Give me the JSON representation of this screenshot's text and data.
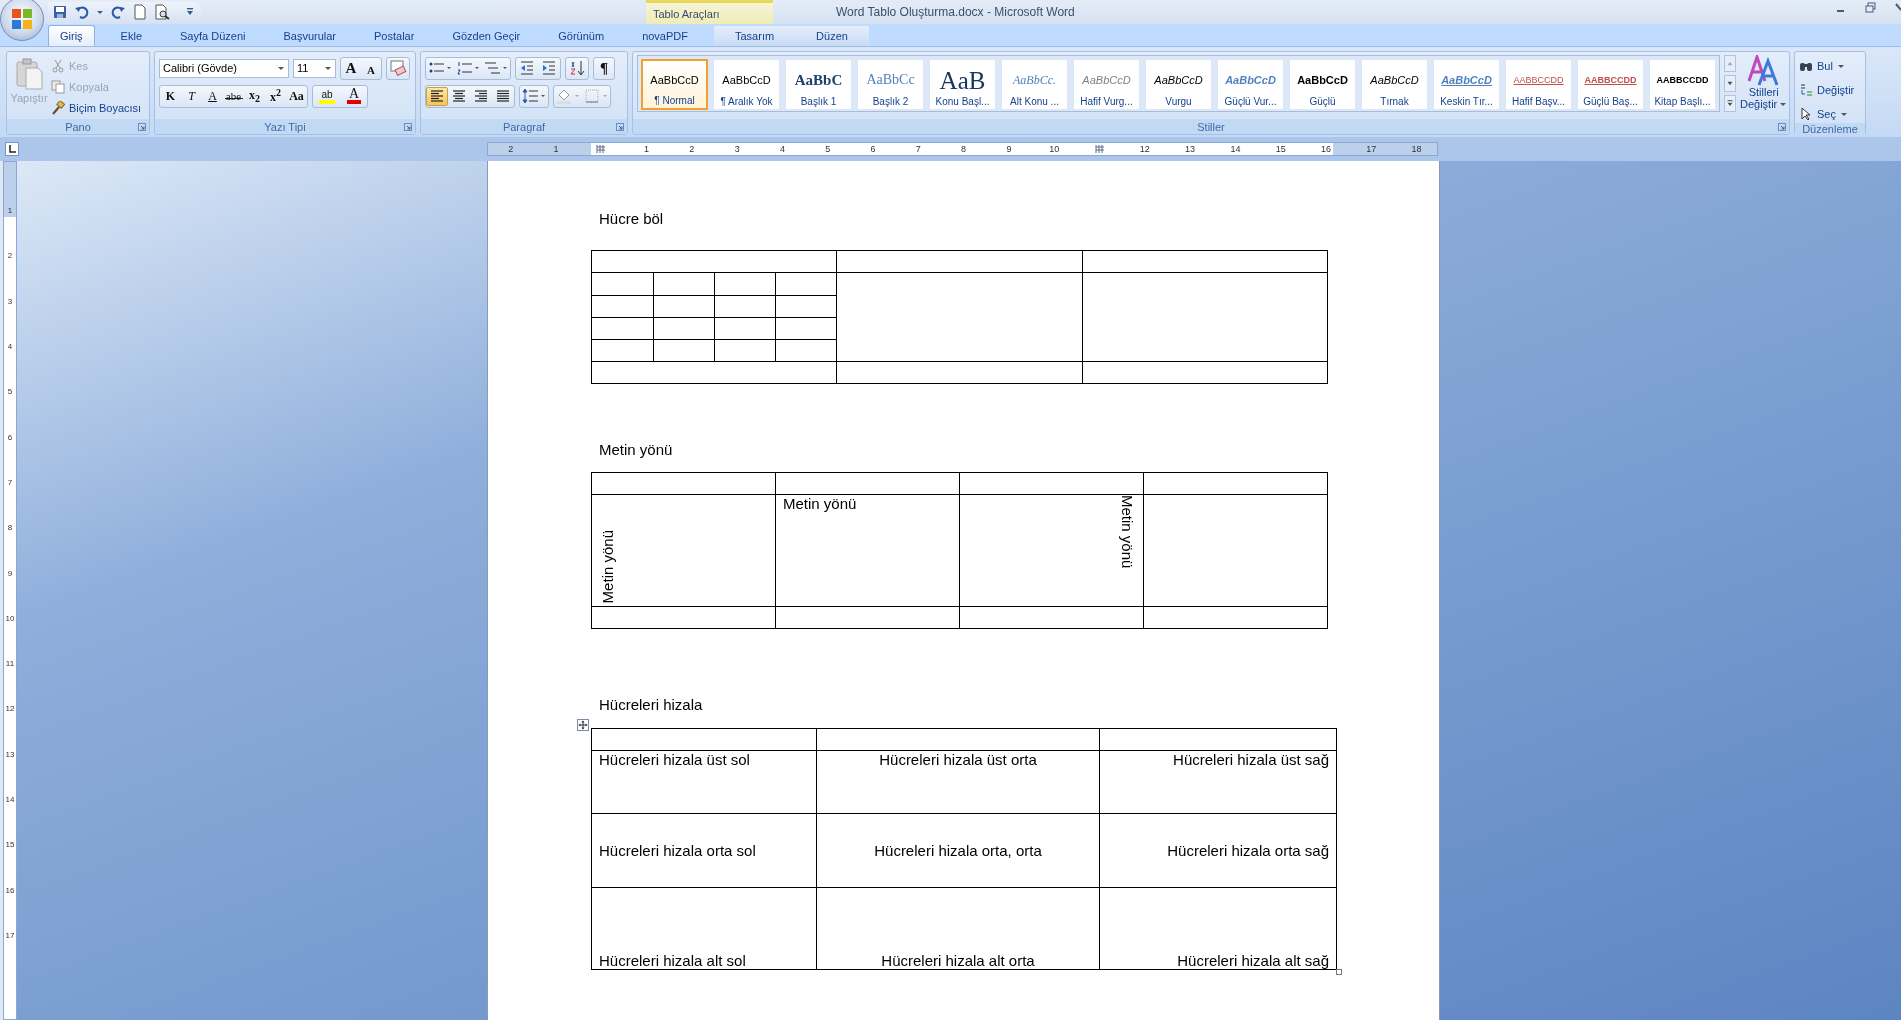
{
  "window": {
    "title": "Word Tablo Oluşturma.docx - Microsoft Word",
    "contextual_group": "Tablo Araçları"
  },
  "tabs": [
    {
      "label": "Giriş",
      "selected": true,
      "kind": "normal"
    },
    {
      "label": "Ekle",
      "selected": false,
      "kind": "normal"
    },
    {
      "label": "Sayfa Düzeni",
      "selected": false,
      "kind": "normal"
    },
    {
      "label": "Başvurular",
      "selected": false,
      "kind": "normal"
    },
    {
      "label": "Postalar",
      "selected": false,
      "kind": "normal"
    },
    {
      "label": "Gözden Geçir",
      "selected": false,
      "kind": "normal"
    },
    {
      "label": "Görünüm",
      "selected": false,
      "kind": "normal"
    },
    {
      "label": "novaPDF",
      "selected": false,
      "kind": "normal"
    },
    {
      "label": "Tasarım",
      "selected": false,
      "kind": "contextual"
    },
    {
      "label": "Düzen",
      "selected": false,
      "kind": "contextual"
    }
  ],
  "clipboard": {
    "group": "Pano",
    "paste": {
      "label": "Yapıştır",
      "disabled": true
    },
    "items": [
      {
        "label": "Kes",
        "kind": "cut",
        "disabled": true
      },
      {
        "label": "Kopyala",
        "kind": "copy",
        "disabled": true
      },
      {
        "label": "Biçim Boyacısı",
        "kind": "brush",
        "disabled": false
      }
    ]
  },
  "font": {
    "group": "Yazı Tipi",
    "family": "Calibri (Gövde)",
    "size": "11",
    "grow": "A",
    "shrink": "A",
    "buttons": [
      {
        "label": "K",
        "kind": "bold"
      },
      {
        "label": "T",
        "kind": "italic"
      },
      {
        "label": "A",
        "kind": "underline"
      },
      {
        "label": "abe",
        "kind": "strike"
      },
      {
        "label": "x$_{2}$",
        "kind": "sub"
      },
      {
        "label": "x$^{2}$",
        "kind": "sup"
      },
      {
        "label": "Aa",
        "kind": "case"
      }
    ],
    "highlight_label": "ab",
    "color_label": "A"
  },
  "paragraph": {
    "group": "Paragraf",
    "pilcrow": "¶",
    "alignments": [
      {
        "kind": "left",
        "selected": true
      },
      {
        "kind": "center",
        "selected": false
      },
      {
        "kind": "right",
        "selected": false
      },
      {
        "kind": "justify",
        "selected": false
      }
    ]
  },
  "styles": {
    "group": "Stiller",
    "change_label": "Stilleri",
    "change_label_2": "Değiştir",
    "items": [
      {
        "sample": "AaBbCcD",
        "label": "¶ Normal",
        "selected": true
      },
      {
        "sample": "AaBbCcD",
        "label": "¶ Aralık Yok",
        "selected": false
      },
      {
        "sample": "AaBbC",
        "label": "Başlık 1",
        "selected": false
      },
      {
        "sample": "AaBbCc",
        "label": "Başlık 2",
        "selected": false
      },
      {
        "sample": "AaB",
        "label": "Konu Başl...",
        "selected": false
      },
      {
        "sample": "AaBbCc.",
        "label": "Alt Konu ...",
        "selected": false
      },
      {
        "sample": "AaBbCcD",
        "label": "Hafif Vurg...",
        "selected": false
      },
      {
        "sample": "AaBbCcD",
        "label": "Vurgu",
        "selected": false
      },
      {
        "sample": "AaBbCcD",
        "label": "Güçlü Vur...",
        "selected": false
      },
      {
        "sample": "AaBbCcD",
        "label": "Güçlü",
        "selected": false
      },
      {
        "sample": "AaBbCcD",
        "label": "Tırnak",
        "selected": false
      },
      {
        "sample": "AaBbCcD",
        "label": "Keskin Tır...",
        "selected": false
      },
      {
        "sample": "AABBCCDD",
        "label": "Hafif Başv...",
        "selected": false
      },
      {
        "sample": "AABBCCDD",
        "label": "Güçlü Baş...",
        "selected": false
      },
      {
        "sample": "AABBCCDD",
        "label": "Kitap Başlı...",
        "selected": false
      }
    ]
  },
  "editing": {
    "group": "Düzenleme",
    "items": [
      {
        "label": "Bul",
        "kind": "find"
      },
      {
        "label": "Değiştir",
        "kind": "replace"
      },
      {
        "label": "Seç",
        "kind": "select"
      }
    ]
  },
  "ruler": [
    {
      "kind": "number",
      "label": "2"
    },
    {
      "kind": "number",
      "label": "1"
    },
    {
      "kind": "marker"
    },
    {
      "kind": "number",
      "label": "1"
    },
    {
      "kind": "number",
      "label": "2"
    },
    {
      "kind": "number",
      "label": "3"
    },
    {
      "kind": "number",
      "label": "4"
    },
    {
      "kind": "number",
      "label": "5"
    },
    {
      "kind": "number",
      "label": "6"
    },
    {
      "kind": "number",
      "label": "7"
    },
    {
      "kind": "number",
      "label": "8"
    },
    {
      "kind": "number",
      "label": "9"
    },
    {
      "kind": "number",
      "label": "10"
    },
    {
      "kind": "marker"
    },
    {
      "kind": "number",
      "label": "12"
    },
    {
      "kind": "number",
      "label": "13"
    },
    {
      "kind": "number",
      "label": "14"
    },
    {
      "kind": "number",
      "label": "15"
    },
    {
      "kind": "number",
      "label": "16"
    },
    {
      "kind": "number",
      "label": "17"
    },
    {
      "kind": "number",
      "label": "18"
    }
  ],
  "vertical_ruler": [
    "1",
    "2",
    "3",
    "4",
    "5",
    "6",
    "7",
    "8",
    "9",
    "10",
    "11",
    "12",
    "13",
    "14",
    "15",
    "16",
    "17"
  ],
  "document": [
    {
      "heading": "Hücre böl",
      "kind": "split"
    },
    {
      "heading": "Metin yönü",
      "kind": "direction",
      "rows": [
        [
          {},
          {},
          {},
          {}
        ],
        [
          {
            "text": "Metin yönü",
            "kind": "up"
          },
          {
            "text": "Metin yönü",
            "kind": "horizontal"
          },
          {
            "text": "Metin yönü",
            "kind": "down"
          },
          {}
        ],
        [
          {},
          {},
          {},
          {}
        ]
      ]
    },
    {
      "heading": "Hücreleri hizala",
      "kind": "align",
      "rows": [
        [
          {},
          {},
          {}
        ],
        [
          {
            "text": "Hücreleri hizala üst sol",
            "kind": "top-left"
          },
          {
            "text": "Hücreleri hizala üst orta",
            "kind": "top-center"
          },
          {
            "text": "Hücreleri hizala üst sağ",
            "kind": "top-right"
          }
        ],
        [
          {
            "text": "Hücreleri hizala orta sol",
            "kind": "middle-left"
          },
          {
            "text": "Hücreleri hizala orta, orta",
            "kind": "middle-center"
          },
          {
            "text": "Hücreleri hizala orta sağ",
            "kind": "middle-right"
          }
        ],
        [
          {
            "text": "Hücreleri hizala alt sol",
            "kind": "bottom-left"
          },
          {
            "text": "Hücreleri hizala alt orta",
            "kind": "bottom-center"
          },
          {
            "text": "Hücreleri hizala alt sağ",
            "kind": "bottom-right"
          }
        ]
      ]
    }
  ]
}
